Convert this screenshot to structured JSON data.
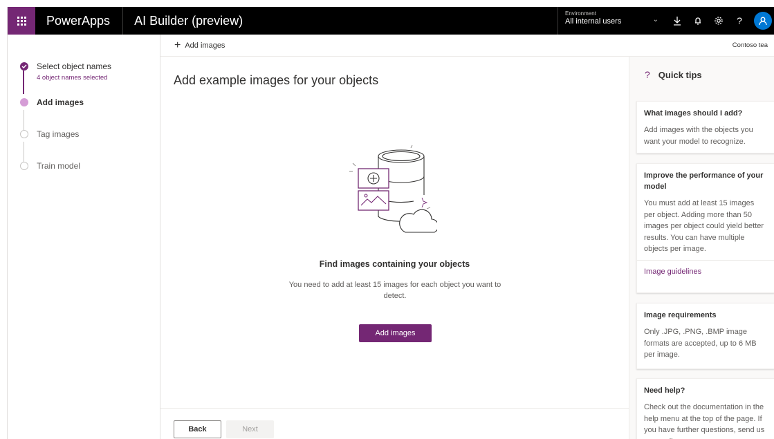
{
  "header": {
    "app_name": "PowerApps",
    "product_title": "AI Builder (preview)",
    "environment_label": "Environment",
    "environment_value": "All internal users",
    "icons": [
      "waffle-icon",
      "download-icon",
      "bell-icon",
      "gear-icon",
      "help-icon",
      "user-icon"
    ],
    "help_glyph": "?"
  },
  "stepper": {
    "steps": [
      {
        "label": "Select object names",
        "sublabel": "4 object names selected",
        "state": "done"
      },
      {
        "label": "Add images",
        "state": "active"
      },
      {
        "label": "Tag images",
        "state": "todo"
      },
      {
        "label": "Train model",
        "state": "todo"
      }
    ]
  },
  "commandbar": {
    "add_images": "Add images",
    "tenant": "Contoso tea"
  },
  "main": {
    "title": "Add example images for your objects",
    "empty_title": "Find images containing your objects",
    "empty_desc": "You need to add at least 15 images for each object you want to detect.",
    "primary_button": "Add images",
    "back_button": "Back",
    "next_button": "Next"
  },
  "tips": {
    "heading": "Quick tips",
    "cards": [
      {
        "title": "What images should I add?",
        "body": "Add images with the objects you want your model to recognize."
      },
      {
        "title": "Improve the performance of your model",
        "body": "You must add at least 15 images per object. Adding more than 50 images per object could yield better results. You can have multiple objects per image.",
        "link": "Image guidelines"
      },
      {
        "title": "Image requirements",
        "body": "Only .JPG, .PNG, .BMP image formats are accepted, up to 6 MB per image."
      },
      {
        "title": "Need help?",
        "body": "Check out the documentation in the help menu at the top of the page. If you have further questions, send us an email."
      }
    ]
  },
  "colors": {
    "brand": "#742774",
    "header_bg": "#000000",
    "avatar": "#0078d4",
    "active_step": "#d59dd6"
  }
}
